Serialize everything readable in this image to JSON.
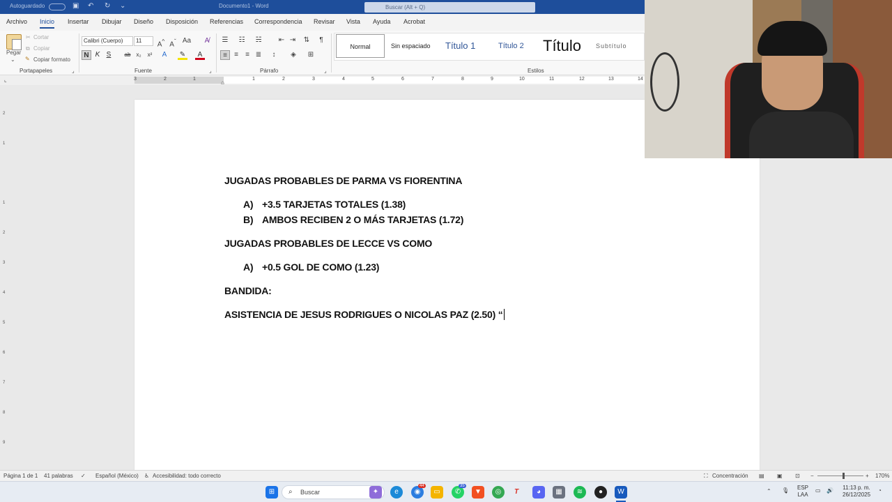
{
  "titlebar": {
    "autosave": "Autoguardado",
    "document_title": "Documento1 - Word",
    "search_placeholder": "Buscar (Alt + Q)"
  },
  "tabs": [
    "Archivo",
    "Inicio",
    "Insertar",
    "Dibujar",
    "Diseño",
    "Disposición",
    "Referencias",
    "Correspondencia",
    "Revisar",
    "Vista",
    "Ayuda",
    "Acrobat"
  ],
  "ribbon": {
    "clipboard": {
      "paste": "Pegar",
      "cut": "Cortar",
      "copy": "Copiar",
      "format_painter": "Copiar formato",
      "label": "Portapapeles"
    },
    "font": {
      "family": "Calibri (Cuerpo)",
      "size": "11",
      "label": "Fuente",
      "bold": "N",
      "italic": "K",
      "underline": "S",
      "strike": "ab",
      "subscript": "x₂",
      "superscript": "x²"
    },
    "paragraph": {
      "label": "Párrafo"
    },
    "styles": {
      "label": "Estilos",
      "items": [
        "Normal",
        "Sin espaciado",
        "Título 1",
        "Título 2",
        "Título",
        "Subtítulo"
      ]
    }
  },
  "ruler": {
    "numbers": [
      "3",
      "2",
      "1",
      "1",
      "2",
      "3",
      "4",
      "5",
      "6",
      "7",
      "8",
      "9",
      "10",
      "11",
      "12",
      "13",
      "14"
    ]
  },
  "vruler": {
    "numbers": [
      "2",
      "1",
      "1",
      "2",
      "3",
      "4",
      "5",
      "6",
      "7",
      "8",
      "9"
    ]
  },
  "document": {
    "heading1": "JUGADAS PROBABLES DE PARMA VS FIORENTINA",
    "list1": [
      {
        "marker": "A)",
        "text": "+3.5 TARJETAS TOTALES (1.38)"
      },
      {
        "marker": "B)",
        "text": "AMBOS RECIBEN 2 O MÁS TARJETAS (1.72)"
      }
    ],
    "heading2": "JUGADAS PROBABLES DE LECCE VS COMO",
    "list2": [
      {
        "marker": "A)",
        "text": "+0.5 GOL DE COMO (1.23)"
      }
    ],
    "heading3": "BANDIDA:",
    "line4": "ASISTENCIA DE JESUS RODRIGUES O NICOLAS PAZ (2.50) “"
  },
  "statusbar": {
    "page": "Página 1 de 1",
    "words": "41 palabras",
    "language": "Español (México)",
    "accessibility": "Accesibilidad: todo correcto",
    "focus": "Concentración",
    "zoom": "170%"
  },
  "taskbar": {
    "search_placeholder": "Buscar",
    "badge_edge": "44",
    "badge_whatsapp": "35",
    "lang_top": "ESP",
    "lang_bottom": "LAA",
    "time": "11:13 p. m.",
    "date": "26/12/2025"
  },
  "colors": {
    "accent": "#1e4e9b",
    "taskbar": "#e7ecf3"
  }
}
